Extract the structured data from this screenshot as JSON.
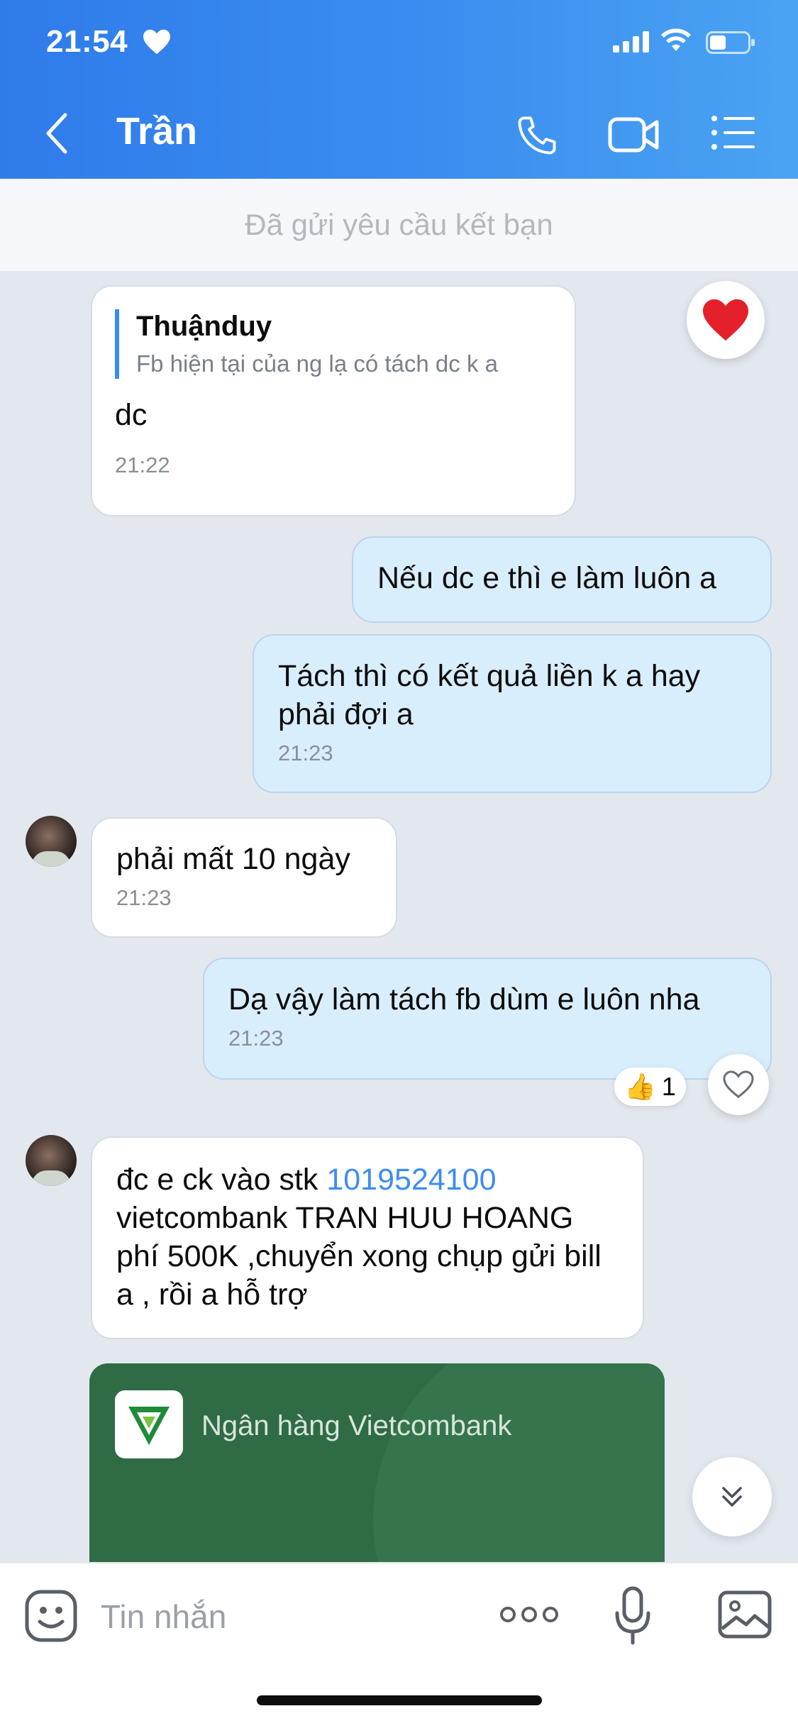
{
  "status_bar": {
    "time": "21:54"
  },
  "header": {
    "contact_name": "Trần"
  },
  "banner": {
    "text": "Đã gửi yêu cầu kết bạn"
  },
  "messages": [
    {
      "dir": "in",
      "quote_name": "Thuậnduy",
      "quote_text": "Fb hiện tại của ng lạ có tách dc k a",
      "text": "dc",
      "time": "21:22"
    },
    {
      "dir": "out",
      "text": "Nếu dc e thì e làm luôn a"
    },
    {
      "dir": "out",
      "text": "Tách thì có kết quả liền k a hay phải đợi a",
      "time": "21:23"
    },
    {
      "dir": "in",
      "text": "phải mất 10 ngày",
      "time": "21:23"
    },
    {
      "dir": "out",
      "text": "Dạ vậy làm tách fb dùm e luôn nha",
      "time": "21:23",
      "reaction_count": "1"
    },
    {
      "dir": "in",
      "text_before": "đc e ck vào stk ",
      "account_number": "1019524100",
      "text_after": "vietcombank TRAN HUU HOANG phí 500K ,chuyển xong chụp gửi bill a , rồi a hỗ trợ"
    }
  ],
  "bank_card": {
    "name": "Ngân hàng Vietcombank"
  },
  "input": {
    "placeholder": "Tin nhắn"
  },
  "colors": {
    "header_start": "#2f7bea",
    "header_end": "#4aa3f2",
    "outgoing_bubble": "#d9eefd",
    "link": "#3d8cf2",
    "bank_card": "#2f6b45"
  }
}
